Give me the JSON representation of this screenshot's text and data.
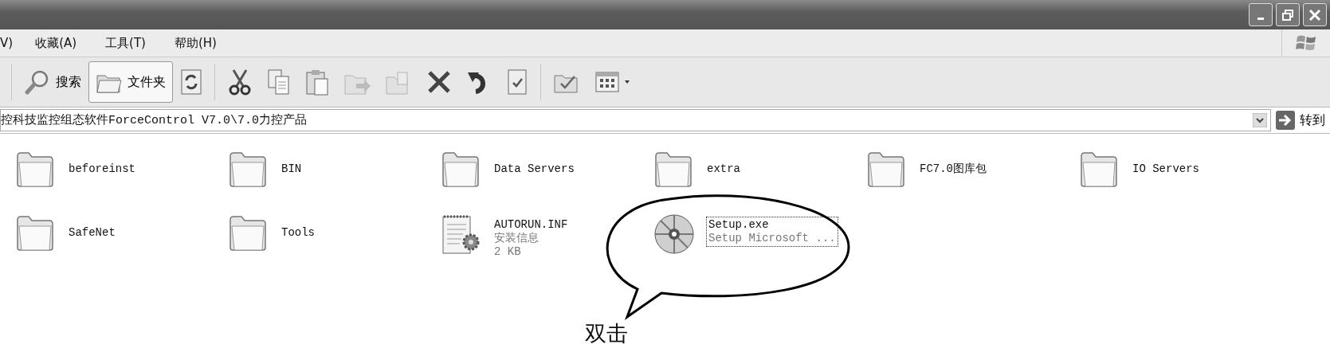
{
  "menu": [
    "V)",
    "收藏(A)",
    "工具(T)",
    "帮助(H)"
  ],
  "toolbar": [
    {
      "kind": "search",
      "label": "搜索",
      "selected": false,
      "disabled": false
    },
    {
      "kind": "folders",
      "label": "文件夹",
      "selected": true,
      "disabled": false
    },
    {
      "kind": "refresh",
      "selected": false,
      "disabled": false
    },
    {
      "kind": "separator"
    },
    {
      "kind": "cut",
      "selected": false,
      "disabled": false
    },
    {
      "kind": "copy",
      "selected": false,
      "disabled": false
    },
    {
      "kind": "paste",
      "selected": false,
      "disabled": false
    },
    {
      "kind": "move-to",
      "selected": false,
      "disabled": true
    },
    {
      "kind": "copy-to",
      "selected": false,
      "disabled": true
    },
    {
      "kind": "delete",
      "selected": false,
      "disabled": false
    },
    {
      "kind": "undo",
      "selected": false,
      "disabled": false
    },
    {
      "kind": "properties",
      "selected": false,
      "disabled": false
    },
    {
      "kind": "separator"
    },
    {
      "kind": "folder-options",
      "selected": false,
      "disabled": false
    },
    {
      "kind": "views",
      "selected": false,
      "disabled": false
    }
  ],
  "address_bar": {
    "value": "控科技监控组态软件ForceControl V7.0\\7.0力控产品",
    "go_label": "转到"
  },
  "files": [
    {
      "kind": "folder",
      "name": "beforeinst",
      "selected": false
    },
    {
      "kind": "folder",
      "name": "BIN",
      "selected": false
    },
    {
      "kind": "folder",
      "name": "Data Servers",
      "selected": false
    },
    {
      "kind": "folder",
      "name": "extra",
      "selected": false
    },
    {
      "kind": "folder",
      "name": "FC7.0图库包",
      "selected": false
    },
    {
      "kind": "folder",
      "name": "IO Servers",
      "selected": false
    },
    {
      "kind": "folder",
      "name": "SafeNet",
      "selected": false
    },
    {
      "kind": "folder",
      "name": "Tools",
      "selected": false
    },
    {
      "kind": "text-file",
      "name": "AUTORUN.INF",
      "details": [
        "安装信息",
        "2 KB"
      ],
      "selected": false
    },
    {
      "kind": "disc",
      "name": "Setup.exe",
      "details": [
        "Setup Microsoft ..."
      ],
      "selected": true
    }
  ],
  "callout": {
    "text": "双击"
  }
}
